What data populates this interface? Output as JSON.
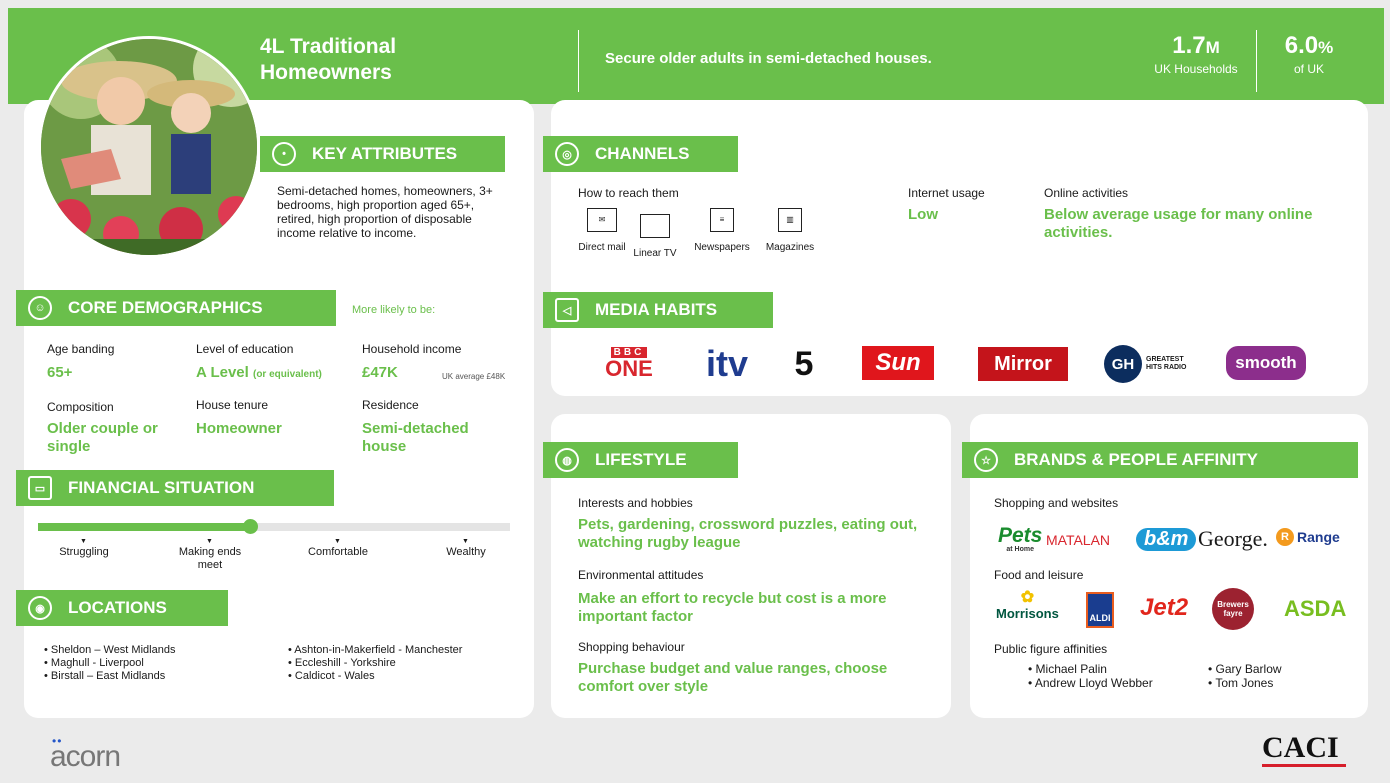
{
  "header": {
    "title": "4L Traditional Homeowners",
    "tagline": "Secure older adults in semi-detached houses.",
    "households_value": "1.7",
    "households_unit": "M",
    "households_label": "UK Households",
    "share_value": "6.0",
    "share_unit": "%",
    "share_label": "of UK"
  },
  "key_attributes": {
    "title": "KEY ATTRIBUTES",
    "text": "Semi-detached homes, homeowners, 3+ bedrooms, high proportion aged 65+, retired, high proportion of disposable income relative to income."
  },
  "core_demographics": {
    "title": "CORE DEMOGRAPHICS",
    "more_likely": "More likely to be:",
    "age_label": "Age banding",
    "age_value": "65+",
    "education_label": "Level of education",
    "education_value": "A Level",
    "education_note": "(or equivalent)",
    "income_label": "Household income",
    "income_value": "£47K",
    "income_note": "UK average £48K",
    "composition_label": "Composition",
    "composition_value": "Older couple or single",
    "tenure_label": "House tenure",
    "tenure_value": "Homeowner",
    "residence_label": "Residence",
    "residence_value": "Semi-detached house"
  },
  "financial": {
    "title": "FINANCIAL SITUATION",
    "level": 0.45,
    "labels": [
      "Struggling",
      "Making ends meet",
      "Comfortable",
      "Wealthy"
    ]
  },
  "locations": {
    "title": "LOCATIONS",
    "left": [
      "• Sheldon – West Midlands",
      "• Maghull - Liverpool",
      "• Birstall – East Midlands"
    ],
    "right": [
      "• Ashton-in-Makerfield - Manchester",
      "• Eccleshill - Yorkshire",
      "• Caldicot - Wales"
    ]
  },
  "channels": {
    "title": "CHANNELS",
    "reach_label": "How to reach them",
    "items": [
      "Direct mail",
      "Linear TV",
      "Newspapers",
      "Magazines"
    ],
    "internet_label": "Internet usage",
    "internet_value": "Low",
    "online_label": "Online activities",
    "online_value": "Below average usage for many online activities."
  },
  "media": {
    "title": "MEDIA HABITS",
    "bbc_top": "BBC",
    "bbc_bottom": "ONE",
    "itv": "itv",
    "five": "5",
    "sun": "Sun",
    "mirror": "Mirror",
    "gh": "GH",
    "gh_text": "GREATEST HITS RADIO",
    "smooth": "smooth"
  },
  "lifestyle": {
    "title": "LIFESTYLE",
    "interests_label": "Interests and hobbies",
    "interests_value": "Pets, gardening, crossword puzzles, eating out, watching rugby league",
    "env_label": "Environmental attitudes",
    "env_value": "Make an effort to recycle but cost is a more important factor",
    "shopping_label": "Shopping behaviour",
    "shopping_value": "Purchase budget and value ranges, choose comfort over style"
  },
  "brands": {
    "title": "BRANDS & PEOPLE AFFINITY",
    "shopping_label": "Shopping and websites",
    "pets": "Pets",
    "pets_sub": "at Home",
    "matalan": "MATALAN",
    "bm": "b&m",
    "george": "George.",
    "range": "Range",
    "food_label": "Food and leisure",
    "morrisons": "Morrisons",
    "aldi": "ALDI",
    "jet2": "Jet2",
    "brewers": "Brewers fayre",
    "asda": "ASDA",
    "public_label": "Public figure affinities",
    "people_left": [
      "• Michael Palin",
      "• Andrew Lloyd Webber"
    ],
    "people_right": [
      "• Gary Barlow",
      "• Tom Jones"
    ]
  },
  "footer": {
    "acorn": "acorn",
    "caci": "CACI"
  },
  "colors": {
    "accent": "#6abf4b",
    "background": "#ebebeb",
    "panel": "#ffffff"
  }
}
